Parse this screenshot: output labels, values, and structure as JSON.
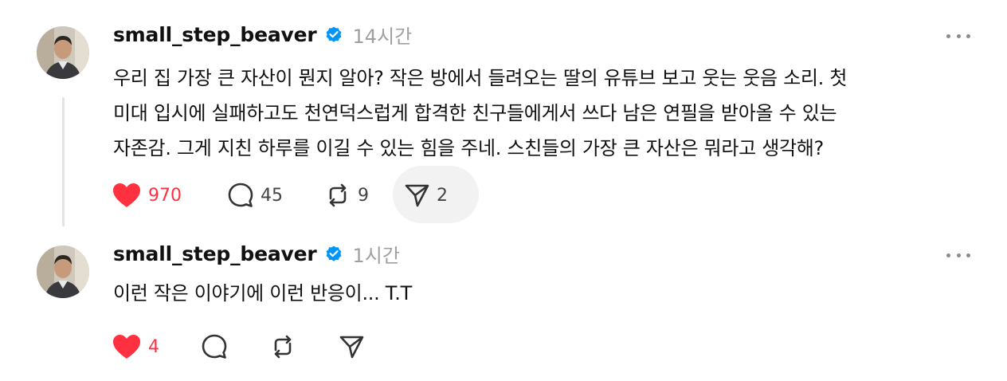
{
  "posts": [
    {
      "username": "small_step_beaver",
      "time": "14시간",
      "text": [
        "우리 집 가장 큰 자산이 뭔지 알아? 작은 방에서 들려오는 딸의 유튜브 보고 웃는 웃음 소리. 첫",
        "미대 입시에 실패하고도 천연덕스럽게 합격한 친구들에게서 쓰다 남은 연필을 받아올 수 있는",
        "자존감. 그게 지친 하루를 이길 수 있는 힘을 주네. 스친들의 가장 큰 자산은 뭐라고 생각해?"
      ],
      "likes": "970",
      "comments": "45",
      "reposts": "9",
      "shares": "2"
    },
    {
      "username": "small_step_beaver",
      "time": "1시간",
      "text": [
        "이런 작은 이야기에 이런 반응이... T.T"
      ],
      "likes": "4"
    }
  ],
  "colors": {
    "like": "#ff3040",
    "verified": "#0095f6",
    "muted": "#a0a0a0"
  },
  "icons": [
    "heart-icon",
    "comment-icon",
    "repost-icon",
    "share-icon",
    "verified-badge-icon",
    "more-icon"
  ]
}
